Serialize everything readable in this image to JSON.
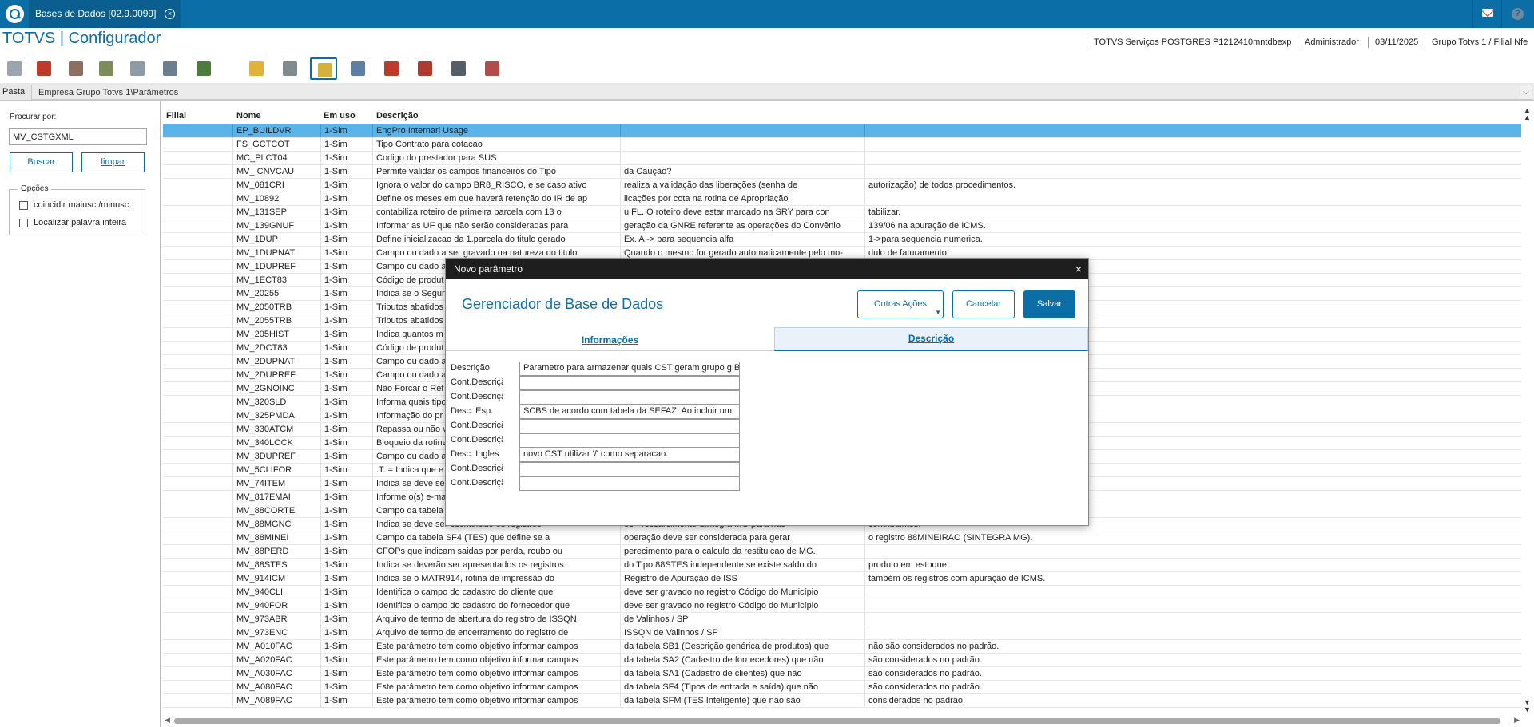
{
  "window": {
    "tab_title": "Bases de Dados [02.9.0099]",
    "tab_close_glyph": "×",
    "help_glyph": "?"
  },
  "header": {
    "app_title": "TOTVS | Configurador",
    "server": "TOTVS Serviços POSTGRES P1212410mntdbexp",
    "user": "Administrador",
    "date": "03/11/2025",
    "branch": "Grupo Totvs 1 / Filial Nfe"
  },
  "toolbar": {
    "icons": [
      "copy-icon",
      "cut-icon",
      "paste-icon",
      "book-icon",
      "print-icon",
      "help-icon",
      "exit-icon",
      "folder-icon",
      "grid-icon",
      "new-parameter-icon",
      "search-doc-icon",
      "edit-icon",
      "delete-icon",
      "filter-icon",
      "copy-doc-icon"
    ],
    "active_index": 9
  },
  "pasta": {
    "label": "Pasta",
    "path": "Empresa Grupo Totvs 1\\Parâmetros",
    "dropdown_glyph": "⌵"
  },
  "search": {
    "label": "Procurar por:",
    "value": "MV_CSTGXML",
    "buscar_label": "Buscar",
    "limpar_label": "limpar",
    "opcoes_label": "Opções",
    "opt_case_label": "coincidir maiusc./minusc",
    "opt_word_label": "Localizar palavra inteira"
  },
  "grid": {
    "headers": [
      "Filial",
      "Nome",
      "Em uso",
      "Descrição"
    ],
    "rows": [
      [
        "",
        "EP_BUILDVR",
        "1-Sim",
        "EngPro Internarl Usage",
        "",
        ""
      ],
      [
        "",
        "FS_GCTCOT",
        "1-Sim",
        "Tipo Contrato para cotacao",
        "",
        ""
      ],
      [
        "",
        "MC_PLCT04",
        "1-Sim",
        "Codigo do prestador para SUS",
        "",
        ""
      ],
      [
        "",
        "MV_ CNVCAU",
        "1-Sim",
        "Permite validar os campos financeiros do Tipo",
        "da Caução?",
        ""
      ],
      [
        "",
        "MV_081CRI",
        "1-Sim",
        "Ignora o valor do campo BR8_RISCO, e se caso ativo",
        "realiza a validação das liberações (senha de",
        "autorização) de todos procedimentos."
      ],
      [
        "",
        "MV_10892",
        "1-Sim",
        "Define os meses em que haverá retenção do IR de ap",
        "licações por cota na rotina de Apropriação",
        ""
      ],
      [
        "",
        "MV_131SEP",
        "1-Sim",
        "contabiliza roteiro de primeira parcela com 13 o",
        "u FL. O roteiro deve estar marcado na SRY para con",
        "tabilizar."
      ],
      [
        "",
        "MV_139GNUF",
        "1-Sim",
        "Informar as UF que não serão consideradas para",
        "geração da GNRE referente as operações do Convênio",
        "139/06 na apuração de ICMS."
      ],
      [
        "",
        "MV_1DUP",
        "1-Sim",
        "Define inicializacao da 1.parcela do titulo gerado",
        "Ex. A -> para sequencia alfa",
        "1->para sequencia numerica."
      ],
      [
        "",
        "MV_1DUPNAT",
        "1-Sim",
        "Campo ou dado a ser gravado na natureza do titulo",
        "Quando o mesmo for gerado automaticamente pelo mo-",
        "dulo de faturamento."
      ],
      [
        "",
        "MV_1DUPREF",
        "1-Sim",
        "Campo ou dado a",
        "",
        ""
      ],
      [
        "",
        "MV_1ECT83",
        "1-Sim",
        "Código de produt",
        "",
        ""
      ],
      [
        "",
        "MV_20255",
        "1-Sim",
        "Indica se o Segur",
        "",
        ""
      ],
      [
        "",
        "MV_2050TRB",
        "1-Sim",
        "Tributos abatidos",
        "",
        ""
      ],
      [
        "",
        "MV_2055TRB",
        "1-Sim",
        "Tributos abatidos",
        "",
        ""
      ],
      [
        "",
        "MV_205HIST",
        "1-Sim",
        "Indica quantos m",
        "",
        ""
      ],
      [
        "",
        "MV_2DCT83",
        "1-Sim",
        "Código de produt",
        "",
        ""
      ],
      [
        "",
        "MV_2DUPNAT",
        "1-Sim",
        "Campo ou dado a",
        "",
        ""
      ],
      [
        "",
        "MV_2DUPREF",
        "1-Sim",
        "Campo ou dado a",
        "",
        ""
      ],
      [
        "",
        "MV_2GNOINC",
        "1-Sim",
        "Não Forcar o Ref",
        "",
        ""
      ],
      [
        "",
        "MV_320SLD",
        "1-Sim",
        "Informa quais tipo",
        "",
        ""
      ],
      [
        "",
        "MV_325PMDA",
        "1-Sim",
        "Informação do pr",
        "",
        ""
      ],
      [
        "",
        "MV_330ATCM",
        "1-Sim",
        "Repassa ou não v",
        "",
        ""
      ],
      [
        "",
        "MV_340LOCK",
        "1-Sim",
        "Bloqueio da rotina",
        "",
        ""
      ],
      [
        "",
        "MV_3DUPREF",
        "1-Sim",
        "Campo ou dado a",
        "",
        ""
      ],
      [
        "",
        "MV_5CLIFOR",
        "1-Sim",
        ".T. = Indica que e",
        "",
        ""
      ],
      [
        "",
        "MV_74ITEM",
        "1-Sim",
        "Indica se deve se",
        "",
        ""
      ],
      [
        "",
        "MV_817EMAI",
        "1-Sim",
        "Informe o(s) e-ma",
        "",
        ""
      ],
      [
        "",
        "MV_88CORTE",
        "1-Sim",
        "Campo da tabela",
        "",
        ""
      ],
      [
        "",
        "MV_88MGNC",
        "1-Sim",
        "Indica se deve ser escriturado os registros",
        "88 - ressarcimento Sintegra MG para não",
        "contribuintes."
      ],
      [
        "",
        "MV_88MINEI",
        "1-Sim",
        "Campo da tabela SF4 (TES) que define se a",
        "operação deve ser considerada para gerar",
        "o registro 88MINEIRAO (SINTEGRA MG)."
      ],
      [
        "",
        "MV_88PERD",
        "1-Sim",
        "CFOPs que indicam saidas por perda, roubo ou",
        "perecimento para o calculo da restituicao de MG.",
        ""
      ],
      [
        "",
        "MV_88STES",
        "1-Sim",
        "Indica se deverão ser apresentados os registros",
        "do Tipo 88STES independente se existe saldo do",
        "produto em estoque."
      ],
      [
        "",
        "MV_914ICM",
        "1-Sim",
        "Indica se o MATR914, rotina de impressão do",
        "Registro de Apuração de ISS",
        "também os registros com apuração de ICMS."
      ],
      [
        "",
        "MV_940CLI",
        "1-Sim",
        "Identifica o campo do cadastro do cliente que",
        "deve ser gravado no registro Código do Município",
        ""
      ],
      [
        "",
        "MV_940FOR",
        "1-Sim",
        "Identifica o campo do cadastro do fornecedor que",
        "deve ser gravado no registro Código do Município",
        ""
      ],
      [
        "",
        "MV_973ABR",
        "1-Sim",
        "Arquivo de termo de abertura do registro de ISSQN",
        "de Valinhos / SP",
        ""
      ],
      [
        "",
        "MV_973ENC",
        "1-Sim",
        "Arquivo de termo de encerramento do registro de",
        "ISSQN de Valinhos / SP",
        ""
      ],
      [
        "",
        "MV_A010FAC",
        "1-Sim",
        "Este parâmetro tem como objetivo informar campos",
        "da tabela SB1 (Descrição genérica de produtos) que",
        "não são considerados no padrão."
      ],
      [
        "",
        "MV_A020FAC",
        "1-Sim",
        "Este parâmetro tem como objetivo informar campos",
        "da tabela SA2 (Cadastro de fornecedores) que não",
        "são considerados no padrão."
      ],
      [
        "",
        "MV_A030FAC",
        "1-Sim",
        "Este parâmetro tem como objetivo informar campos",
        "da tabela SA1 (Cadastro de clientes) que não",
        "são considerados no padrão."
      ],
      [
        "",
        "MV_A080FAC",
        "1-Sim",
        "Este parâmetro tem como objetivo informar campos",
        "da tabela SF4 (Tipos de entrada e saída) que não",
        "são considerados no padrão."
      ],
      [
        "",
        "MV_A089FAC",
        "1-Sim",
        "Este parâmetro tem como objetivo informar campos",
        "da tabela SFM (TES Inteligente) que não são",
        "considerados no padrão."
      ]
    ]
  },
  "dialog": {
    "title": "Novo parâmetro",
    "close_glyph": "×",
    "heading": "Gerenciador de Base de Dados",
    "btn_outras": "Outras Ações",
    "btn_cancelar": "Cancelar",
    "btn_salvar": "Salvar",
    "tab_info": "Informações",
    "tab_desc": "Descrição",
    "fields": [
      {
        "label": "Descrição",
        "value": "Parametro para armazenar quais CST geram grupo gIB"
      },
      {
        "label": "Cont.Descrição",
        "value": ""
      },
      {
        "label": "Cont.Descrição",
        "value": ""
      },
      {
        "label": "Desc. Esp.",
        "value": "SCBS de acordo com tabela da SEFAZ. Ao incluir um"
      },
      {
        "label": "Cont.Descrição",
        "value": ""
      },
      {
        "label": "Cont.Descrição",
        "value": ""
      },
      {
        "label": "Desc. Ingles",
        "value": " novo CST utilizar '/' como separacao."
      },
      {
        "label": "Cont.Descrição",
        "value": ""
      },
      {
        "label": "Cont.Descrição",
        "value": ""
      }
    ]
  }
}
